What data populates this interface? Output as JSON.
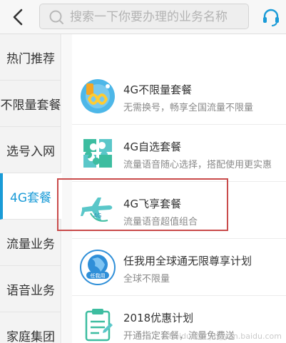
{
  "header": {
    "search_placeholder": "搜索一下你要办理的业务名称"
  },
  "sidebar": {
    "items": [
      {
        "label": "热门推荐"
      },
      {
        "label": "不限量套餐"
      },
      {
        "label": "选号入网"
      },
      {
        "label": "4G套餐",
        "active": true
      },
      {
        "label": "流量业务"
      },
      {
        "label": "语音业务"
      },
      {
        "label": "家庭集团"
      }
    ]
  },
  "list": {
    "items": [
      {
        "title": "4G不限量套餐",
        "subtitle": "无需换号，畅享全国流量不限量",
        "icon": "infinity-phone-icon"
      },
      {
        "title": "4G自选套餐",
        "subtitle": "流量语音随心选择，搭配使用更实惠",
        "icon": "puzzle-icon"
      },
      {
        "title": "4G飞享套餐",
        "subtitle": "流量语音超值组合",
        "icon": "airplane-icon"
      },
      {
        "title": "任我用全球通无限尊享计划",
        "subtitle": "全球不限量",
        "icon": "globe-badge-icon",
        "badge": "任我用"
      },
      {
        "title": "2018优惠计划",
        "subtitle": "开通指定套餐，流量免费送",
        "icon": "clipboard-icon"
      }
    ]
  },
  "colors": {
    "accent": "#1a9bd7",
    "highlight_box": "#c94b4b"
  },
  "watermark": "Baidu经验 jingyan.baidu.com"
}
